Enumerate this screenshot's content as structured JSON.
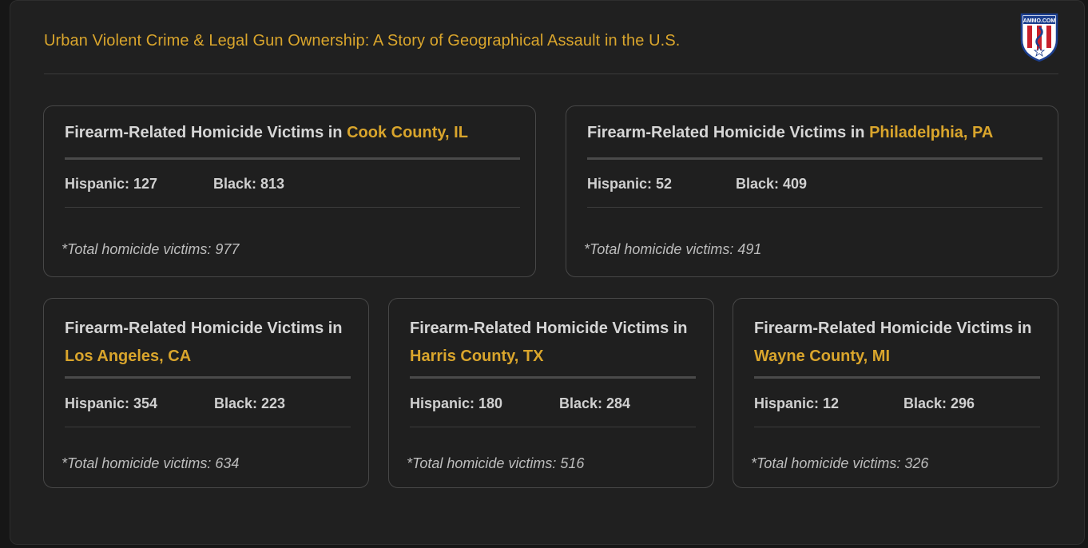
{
  "header": {
    "title": "Urban Violent Crime & Legal Gun Ownership: A Story of Geographical Assault in the U.S.",
    "logo_text": "AMMO.COM"
  },
  "cards": [
    {
      "heading": "Firearm-Related Homicide Victims in ",
      "location": "Cook County, IL",
      "hispanic": "Hispanic: 127",
      "black": "Black:  813",
      "total": "*Total homicide victims: 977"
    },
    {
      "heading": "Firearm-Related Homicide Victims in ",
      "location": "Philadelphia, PA",
      "hispanic": "Hispanic: 52",
      "black": "Black:  409",
      "total": "*Total homicide victims: 491"
    },
    {
      "heading": "Firearm-Related Homicide Victims in ",
      "location": "Los Angeles, CA",
      "hispanic": "Hispanic: 354",
      "black": "Black:  223",
      "total": "*Total homicide victims: 634"
    },
    {
      "heading": "Firearm-Related Homicide Victims in ",
      "location": "Harris County, TX",
      "hispanic": "Hispanic: 180",
      "black": "Black:  284",
      "total": "*Total homicide victims: 516"
    },
    {
      "heading": "Firearm-Related Homicide Victims in ",
      "location": "Wayne County, MI",
      "hispanic": "Hispanic: 12",
      "black": "Black:  296",
      "total": "*Total homicide victims: 326"
    }
  ],
  "colors": {
    "accent": "#d9a52c",
    "background": "#202020",
    "card_border": "#474747"
  }
}
